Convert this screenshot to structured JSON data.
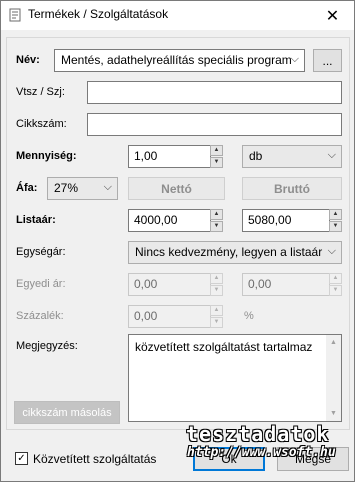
{
  "window": {
    "title": "Termékek / Szolgáltatások",
    "close_glyph": "✕"
  },
  "form": {
    "nev_label": "Név:",
    "nev_value": "Mentés, adathelyreállítás speciális program",
    "nev_browse": "...",
    "vtsz_label": "Vtsz / Szj:",
    "vtsz_value": "",
    "cikkszam_label": "Cikkszám:",
    "cikkszam_value": "",
    "mennyiseg_label": "Mennyiség:",
    "mennyiseg_value": "1,00",
    "unit_value": "db",
    "afa_label": "Áfa:",
    "afa_value": "27%",
    "netto_label": "Nettó",
    "brutto_label": "Bruttó",
    "listaar_label": "Listaár:",
    "listaar_netto": "4000,00",
    "listaar_brutto": "5080,00",
    "egysegar_label": "Egységár:",
    "egysegar_value": "Nincs kedvezmény, legyen a listaár",
    "egyedi_label": "Egyedi ár:",
    "egyedi_netto": "0,00",
    "egyedi_brutto": "0,00",
    "szazalek_label": "Százalék:",
    "szazalek_value": "0,00",
    "szazalek_unit": "%",
    "megjegyzes_label": "Megjegyzés:",
    "megjegyzes_value": "közvetített szolgáltatást tartalmaz",
    "copy_button": "cikkszám másolás"
  },
  "footer": {
    "checkbox_label": "Közvetített szolgáltatás",
    "checkbox_checked": true,
    "check_glyph": "✓",
    "ok_label": "Ok",
    "cancel_label": "Mégse"
  },
  "watermark": {
    "line1": "tesztadatok",
    "line2": "http://www.wsoft.hu"
  },
  "colors": {
    "accent": "#0078d7",
    "disabled_text": "#8e8e8e"
  },
  "icons": {
    "app": "document-icon",
    "dropdown": "chevron-down-icon",
    "spin_up": "triangle-up-icon",
    "spin_down": "triangle-down-icon"
  }
}
